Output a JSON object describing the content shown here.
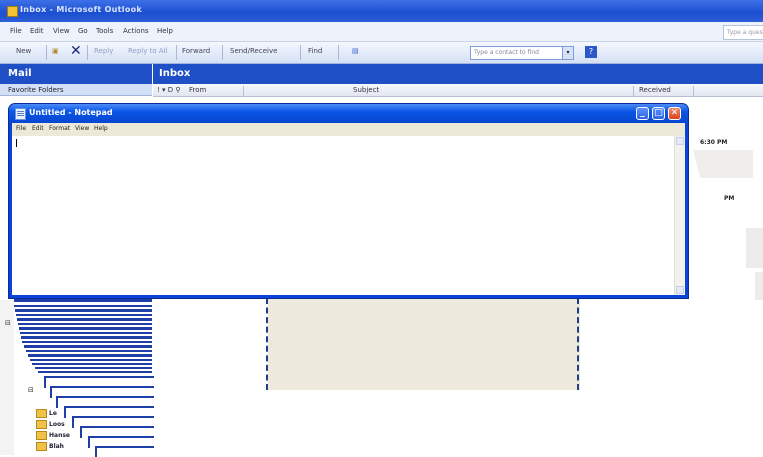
{
  "outlook": {
    "title": "Inbox - Microsoft Outlook",
    "menus": [
      "File",
      "Edit",
      "View",
      "Go",
      "Tools",
      "Actions",
      "Help"
    ],
    "help_placeholder": "Type a question",
    "toolbar": {
      "new": "New",
      "reply": "Reply",
      "reply_all": "Reply to All",
      "forward": "Forward",
      "send_receive": "Send/Receive",
      "find": "Find",
      "contact_placeholder": "Type a contact to find"
    },
    "mail_header": "Mail",
    "favorite_folders": "Favorite Folders",
    "inbox_header": "Inbox",
    "columns": {
      "from": "From",
      "subject": "Subject",
      "received": "Received"
    },
    "fragments": {
      "time": "6:30 PM",
      "pm": "PM"
    },
    "folders": [
      "Le",
      "Loos",
      "Hanse",
      "Blah"
    ]
  },
  "notepad": {
    "title": "Untitled - Notepad",
    "menus": [
      "File",
      "Edit",
      "Format",
      "View",
      "Help"
    ]
  },
  "colors": {
    "title_blue": "#0a56e6",
    "pane_header_blue": "#1f4fc4",
    "close_red": "#d8421a"
  }
}
